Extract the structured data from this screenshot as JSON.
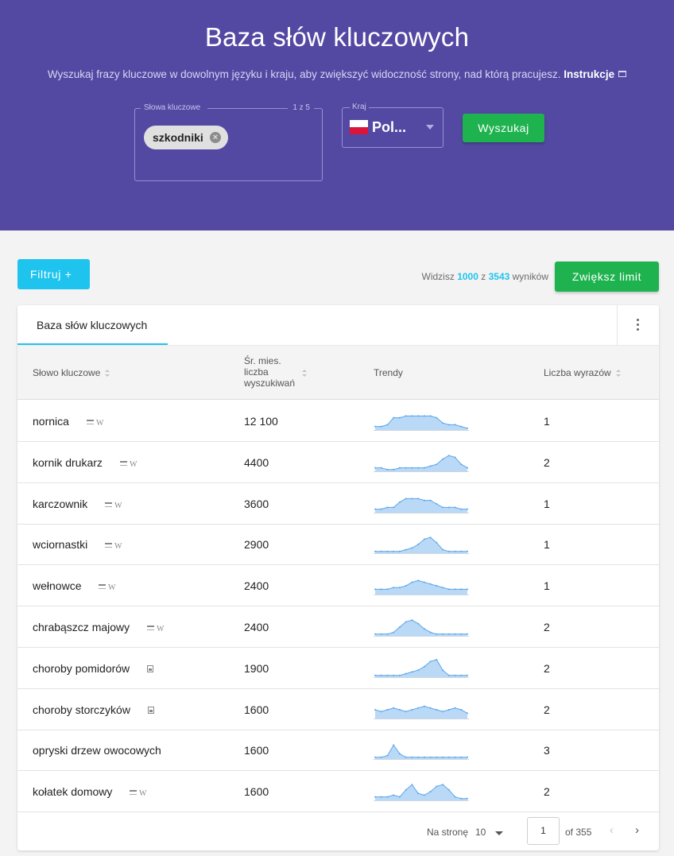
{
  "hero": {
    "title": "Baza słów kluczowych",
    "subtitle": "Wyszukaj frazy kluczowe w dowolnym języku i kraju, aby zwiększyć widoczność strony, nad którą pracujesz.",
    "instructions_link": "Instrukcje"
  },
  "search": {
    "keywords_label": "Słowa kluczowe",
    "keywords_count": "1 z 5",
    "chip": "szkodniki",
    "country_label": "Kraj",
    "country_value": "Pol...",
    "button": "Wyszukaj"
  },
  "toolbar": {
    "filter_button": "Filtruj +",
    "results_prefix": "Widzisz",
    "results_shown": "1000",
    "results_mid": "z",
    "results_total": "3543",
    "results_suffix": "wyników",
    "limit_button": "Zwiększ limit"
  },
  "table": {
    "tab": "Baza słów kluczowych",
    "columns": {
      "keyword": "Słowo kluczowe",
      "volume": "Śr. mies. liczba wyszukiwań",
      "trends": "Trendy",
      "words": "Liczba wyrazów"
    },
    "rows": [
      {
        "keyword": "nornica",
        "volume": "12 100",
        "words": "1",
        "icons": [
          "serp-icon",
          "wiki-icon"
        ],
        "trend": [
          2,
          2,
          3,
          7,
          7,
          8,
          8,
          8,
          8,
          8,
          7,
          4,
          3,
          3,
          2,
          1
        ]
      },
      {
        "keyword": "kornik drukarz",
        "volume": "4400",
        "words": "2",
        "icons": [
          "serp-icon",
          "wiki-icon"
        ],
        "trend": [
          2,
          2,
          1,
          1,
          2,
          2,
          2,
          2,
          2,
          3,
          4,
          7,
          9,
          8,
          4,
          2
        ]
      },
      {
        "keyword": "karczownik",
        "volume": "3600",
        "words": "1",
        "icons": [
          "serp-icon",
          "wiki-icon"
        ],
        "trend": [
          2,
          2,
          3,
          3,
          6,
          8,
          8,
          8,
          7,
          7,
          5,
          3,
          3,
          3,
          2,
          2
        ]
      },
      {
        "keyword": "wciornastki",
        "volume": "2900",
        "words": "1",
        "icons": [
          "serp-icon",
          "wiki-icon"
        ],
        "trend": [
          1,
          1,
          1,
          1,
          1,
          2,
          3,
          5,
          8,
          9,
          6,
          2,
          1,
          1,
          1,
          1
        ]
      },
      {
        "keyword": "wełnowce",
        "volume": "2400",
        "words": "1",
        "icons": [
          "serp-icon",
          "wiki-icon"
        ],
        "trend": [
          3,
          3,
          3,
          4,
          4,
          5,
          7,
          8,
          7,
          6,
          5,
          4,
          3,
          3,
          3,
          3
        ]
      },
      {
        "keyword": "chrabąszcz majowy",
        "volume": "2400",
        "words": "2",
        "icons": [
          "serp-icon",
          "wiki-icon"
        ],
        "trend": [
          1,
          1,
          1,
          2,
          5,
          8,
          9,
          7,
          4,
          2,
          1,
          1,
          1,
          1,
          1,
          1
        ]
      },
      {
        "keyword": "choroby pomidorów",
        "volume": "1900",
        "words": "2",
        "icons": [
          "image-icon"
        ],
        "trend": [
          1,
          1,
          1,
          1,
          1,
          2,
          3,
          4,
          6,
          9,
          10,
          4,
          1,
          1,
          1,
          1
        ]
      },
      {
        "keyword": "choroby storczyków",
        "volume": "1600",
        "words": "2",
        "icons": [
          "image-icon"
        ],
        "trend": [
          5,
          4,
          5,
          6,
          5,
          4,
          5,
          6,
          7,
          6,
          5,
          4,
          5,
          6,
          5,
          3
        ]
      },
      {
        "keyword": "opryski drzew owocowych",
        "volume": "1600",
        "words": "3",
        "icons": [],
        "trend": [
          1,
          1,
          2,
          8,
          3,
          1,
          1,
          1,
          1,
          1,
          1,
          1,
          1,
          1,
          1,
          1
        ]
      },
      {
        "keyword": "kołatek domowy",
        "volume": "1600",
        "words": "2",
        "icons": [
          "serp-icon",
          "wiki-icon"
        ],
        "trend": [
          2,
          2,
          2,
          3,
          2,
          6,
          9,
          4,
          3,
          5,
          8,
          9,
          6,
          2,
          1,
          1
        ]
      }
    ]
  },
  "pagination": {
    "per_page_label": "Na stronę",
    "per_page_value": "10",
    "current_page": "1",
    "of_pages": "of 355",
    "prev": "‹",
    "next": "›"
  },
  "colors": {
    "hero_bg": "#5349a3",
    "accent_cyan": "#1ec4ee",
    "accent_green": "#1fb350",
    "trend_fill": "#b9d9f7",
    "trend_line": "#5da6e8"
  }
}
